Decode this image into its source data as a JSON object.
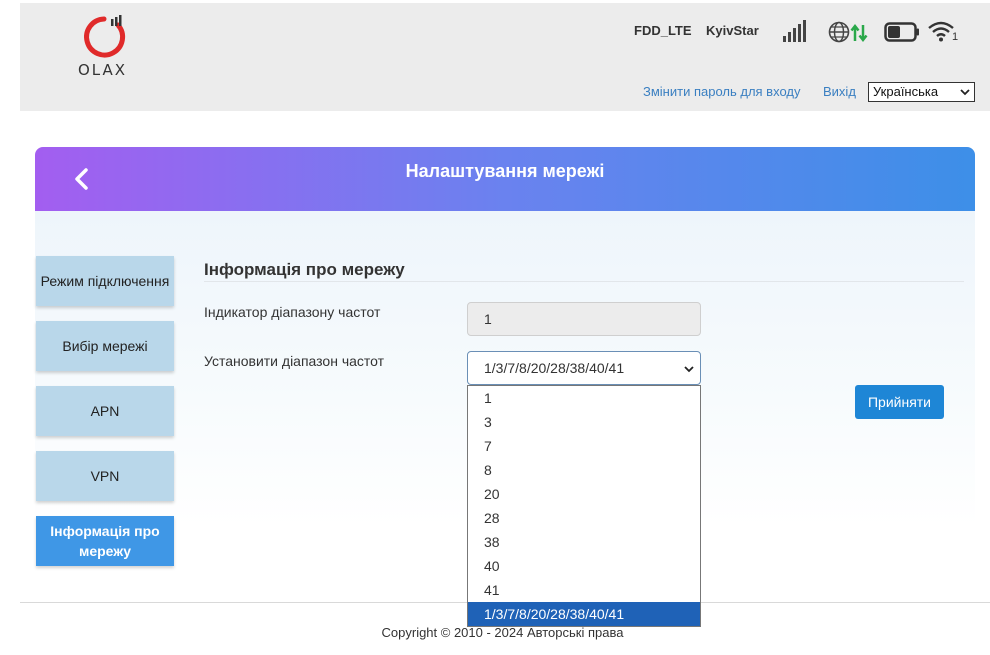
{
  "header": {
    "logo_text": "OLAX",
    "network_type": "FDD_LTE",
    "operator": "KyivStar",
    "wifi_clients": "1",
    "change_password_link": "Змінити пароль для входу",
    "logout_link": "Вихід",
    "language_selected": "Українська",
    "icons": [
      "signal-bars-icon",
      "globe-icon",
      "data-arrows-icon",
      "battery-icon",
      "wifi-icon"
    ]
  },
  "page": {
    "title": "Налаштування мережі",
    "back_icon": "chevron-left-icon"
  },
  "sidebar": {
    "items": [
      {
        "label": "Режим підключення",
        "active": false
      },
      {
        "label": "Вибір мережі",
        "active": false
      },
      {
        "label": "APN",
        "active": false
      },
      {
        "label": "VPN",
        "active": false
      },
      {
        "label": "Інформація про мережу",
        "active": true
      }
    ]
  },
  "main": {
    "section_title": "Інформація про мережу",
    "band_indicator_label": "Індикатор діапазону частот",
    "band_indicator_value": "1",
    "set_band_label": "Установити діапазон частот",
    "set_band_value": "1/3/7/8/20/28/38/40/41",
    "band_options": [
      "1",
      "3",
      "7",
      "8",
      "20",
      "28",
      "38",
      "40",
      "41",
      "1/3/7/8/20/28/38/40/41"
    ],
    "selected_option_index": 9,
    "accept_button": "Прийняти"
  },
  "footer": {
    "copyright": "Copyright © 2010 - 2024 Авторські права"
  },
  "colors": {
    "title_gradient_start": "#a35ef0",
    "title_gradient_end": "#3d8fe8",
    "sidebar_item": "#b9d7ea",
    "sidebar_active": "#3f97e6",
    "accept_button": "#1e86d6",
    "option_highlight": "#1f62b7",
    "link": "#3a7fc1",
    "logo_red": "#e02a2a"
  }
}
